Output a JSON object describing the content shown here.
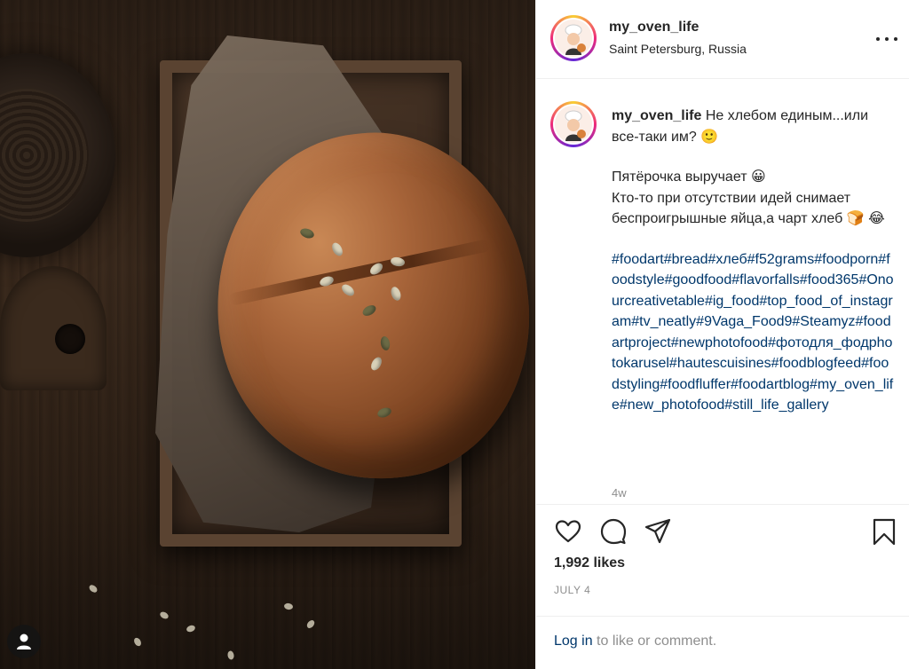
{
  "post": {
    "username": "my_oven_life",
    "location": "Saint Petersburg, Russia",
    "caption": {
      "line1": "Не хлебом единым...или все-таки им? 🙂",
      "line2": "Пятёрочка выручает 😀",
      "line3": "Кто-то при отсутствии идей снимает беспроигрышные яйца,а чарт хлеб 🍞 😂",
      "hashtags": "#foodart#bread#хлеб#f52grams#foodporn#foodstyle#goodfood#flavorfalls#food365#Onourcreativetable#ig_food#top_food_of_instagram#tv_neatly#9Vaga_Food9#Steamyz#foodartproject#newphotofood#фотодля_фодphotokarusel#hautescuisines#foodblogfeed#foodstyling#foodfluffer#foodartblog#my_oven_life#new_photofood#still_life_gallery"
    },
    "time_ago": "4w",
    "likes": "1,992 likes",
    "date": "JULY 4",
    "login": {
      "link": "Log in",
      "rest": " to like or comment."
    }
  },
  "icons": {
    "like": "heart-icon",
    "comment": "comment-icon",
    "share": "share-icon",
    "save": "bookmark-icon",
    "more": "more-icon",
    "profile": "profile-icon"
  },
  "colors": {
    "link": "#00376b",
    "muted": "#8e8e8e",
    "text": "#262626"
  }
}
